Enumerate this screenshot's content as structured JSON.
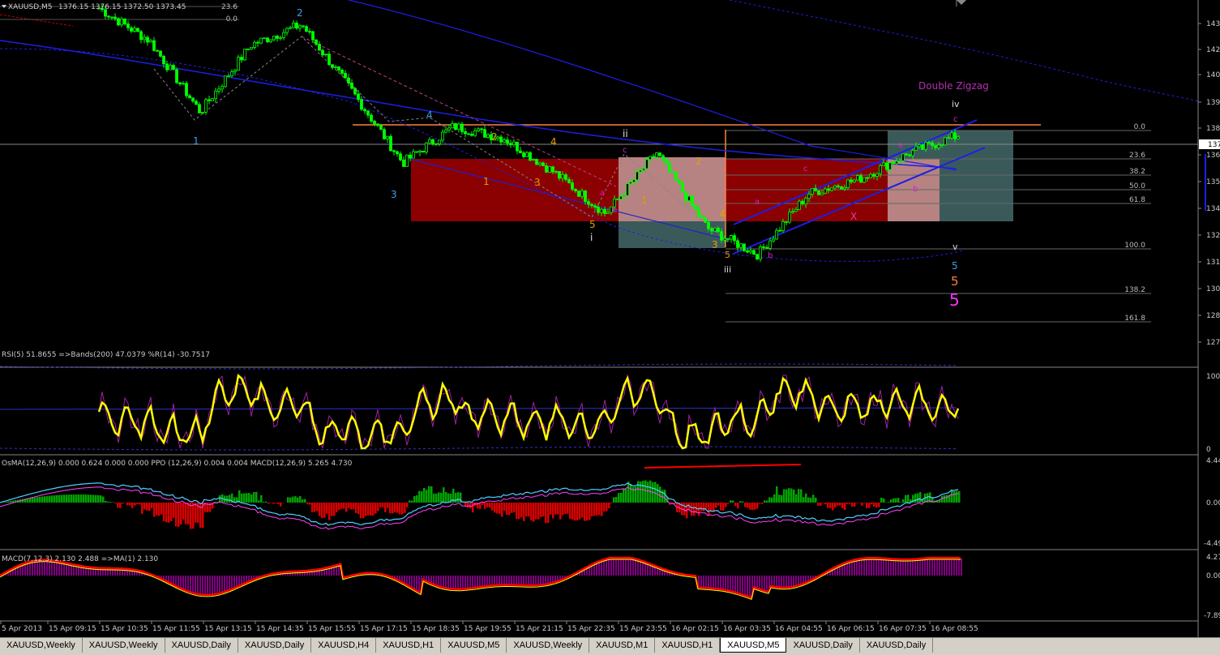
{
  "header": {
    "symbol": "XAUUSD,M5",
    "ohlc": "1376.15 1376.15 1372.50 1373.45"
  },
  "price_axis": [
    "143",
    "142",
    "140",
    "139",
    "138",
    "137",
    "136",
    "135",
    "134",
    "132",
    "131",
    "130",
    "128",
    "127"
  ],
  "fib_levels": [
    "0.0",
    "23.6",
    "38.2",
    "50.0",
    "61.8",
    "100.0",
    "138.2",
    "161.8"
  ],
  "small_fib": [
    "23.6",
    "0.0"
  ],
  "wave_labels": {
    "w2": "2",
    "w1": "1",
    "w3": "3",
    "w4": "4",
    "o2": "2",
    "o1": "1",
    "o4": "4",
    "o3": "3",
    "o5": "5",
    "ri": "i",
    "rii": "ii",
    "c1": "c",
    "a1": "a",
    "b1": "b",
    "o1b": "1",
    "o2b": "2",
    "o4b": "4",
    "o3b": "3",
    "o5b": "5",
    "riii": "iii",
    "a2": "a",
    "c2": "c",
    "b2": "b",
    "x1": "X",
    "a3": "a",
    "b3": "b",
    "riv": "iv",
    "c3": "c",
    "rv": "v",
    "f5a": "5",
    "f5b": "5",
    "f5c": "5",
    "pattern": "Double Zigzag"
  },
  "rsi_panel": {
    "title": "RSI(5) 51.8655 =>Bands(200) 47.0379 %R(14) -30.7517",
    "axis": [
      "100",
      "0"
    ]
  },
  "osma_panel": {
    "title": "OsMA(12,26,9) 0.000 0.624 0.000 0.000 PPO (12,26,9) 0.004 0.004 MACD(12,26,9) 5.265 4.730",
    "axis": [
      "4.44",
      "0.00",
      "-4.49"
    ]
  },
  "macd_panel": {
    "title": "MACD(7,12,3) 2.130 2.488 =>MA(1) 2.130",
    "axis": [
      "4.27",
      "0.00",
      "-7.89"
    ]
  },
  "time_axis": [
    "5 Apr 2013",
    "15 Apr 09:15",
    "15 Apr 10:35",
    "15 Apr 11:55",
    "15 Apr 13:15",
    "15 Apr 14:35",
    "15 Apr 15:55",
    "15 Apr 17:15",
    "15 Apr 18:35",
    "15 Apr 19:55",
    "15 Apr 21:15",
    "15 Apr 22:35",
    "15 Apr 23:55",
    "16 Apr 02:15",
    "16 Apr 03:35",
    "16 Apr 04:55",
    "16 Apr 06:15",
    "16 Apr 07:35",
    "16 Apr 08:55"
  ],
  "tabs": [
    {
      "label": "XAUUSD,Weekly",
      "active": false
    },
    {
      "label": "XAUUSD,Weekly",
      "active": false
    },
    {
      "label": "XAUUSD,Daily",
      "active": false
    },
    {
      "label": "XAUUSD,Daily",
      "active": false
    },
    {
      "label": "XAUUSD,H4",
      "active": false
    },
    {
      "label": "XAUUSD,H1",
      "active": false
    },
    {
      "label": "XAUUSD,M5",
      "active": false
    },
    {
      "label": "XAUUSD,Weekly",
      "active": false
    },
    {
      "label": "XAUUSD,M1",
      "active": false
    },
    {
      "label": "XAUUSD,H1",
      "active": false
    },
    {
      "label": "XAUUSD,M5",
      "active": true
    },
    {
      "label": "XAUUSD,Daily",
      "active": false
    },
    {
      "label": "XAUUSD,Daily",
      "active": false
    }
  ],
  "colors": {
    "bg": "#000000",
    "candle": "#00ff00",
    "box_red": "#8b0000",
    "box_pink": "#e09090",
    "box_teal": "#3a5a5a",
    "channel": "#0000ff",
    "rsi": "#ffff00",
    "wr": "#a020a0",
    "hist_green": "#00c000",
    "hist_red": "#ff0000",
    "hist_purple": "#800080",
    "orange_line": "#ff8040"
  },
  "chart_data": {
    "type": "line",
    "title": "XAUUSD,M5",
    "xlabel": "",
    "ylabel": "",
    "ylim": [
      1270,
      1440
    ],
    "x": [
      "15 Apr 09:15",
      "15 Apr 10:35",
      "15 Apr 11:55",
      "15 Apr 13:15",
      "15 Apr 14:35",
      "15 Apr 15:55",
      "15 Apr 17:15",
      "15 Apr 18:35",
      "15 Apr 19:55",
      "15 Apr 21:15",
      "15 Apr 22:35",
      "15 Apr 23:55",
      "16 Apr 02:15",
      "16 Apr 03:35",
      "16 Apr 04:55",
      "16 Apr 06:15",
      "16 Apr 07:35",
      "16 Apr 08:55"
    ],
    "series": [
      {
        "name": "",
        "values": [
          1436,
          1420,
          1385,
          1418,
          1428,
          1395,
          1360,
          1378,
          1372,
          1355,
          1335,
          1365,
          1328,
          1315,
          1345,
          1352,
          1365,
          1374
        ]
      }
    ],
    "grid": false
  }
}
